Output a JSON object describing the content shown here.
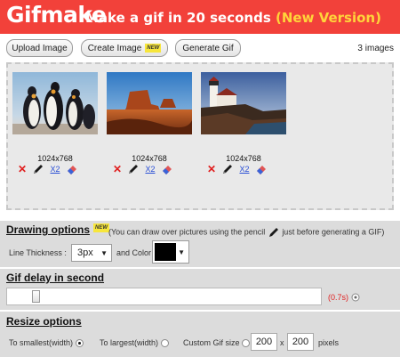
{
  "header": {
    "logo": "Gifmake",
    "tagline": "Make a gif in 20 seconds",
    "version": "(New Version)"
  },
  "toolbar": {
    "upload_label": "Upload Image",
    "create_label": "Create Image",
    "create_badge": "NEW",
    "generate_label": "Generate Gif",
    "image_count": "3 images"
  },
  "images": [
    {
      "resolution": "1024x768",
      "scale_label": "X2",
      "scene": "penguins"
    },
    {
      "resolution": "1024x768",
      "scale_label": "X2",
      "scene": "desert"
    },
    {
      "resolution": "1024x768",
      "scale_label": "X2",
      "scene": "lighthouse"
    }
  ],
  "drawing": {
    "title": "Drawing options",
    "badge": "NEW",
    "hint_before": "(You can draw over pictures using the pencil",
    "hint_after": "just before generating a GIF)",
    "thickness_label": "Line Thickness :",
    "thickness_value": "3px",
    "color_label": "and Color",
    "color_value": "#000000"
  },
  "delay": {
    "title": "Gif delay in second",
    "value_label": "(0.7s)",
    "value": 0.7
  },
  "resize": {
    "title": "Resize options",
    "smallest_label": "To smallest(width)",
    "largest_label": "To largest(width)",
    "custom_label": "Custom Gif size",
    "width": "200",
    "separator": "x",
    "height": "200",
    "unit": "pixels",
    "selected": "smallest"
  },
  "colors": {
    "header_bg": "#f2413a",
    "accent_yellow": "#ffd43a",
    "delete_red": "#e02020",
    "link_blue": "#2a4fd6"
  }
}
